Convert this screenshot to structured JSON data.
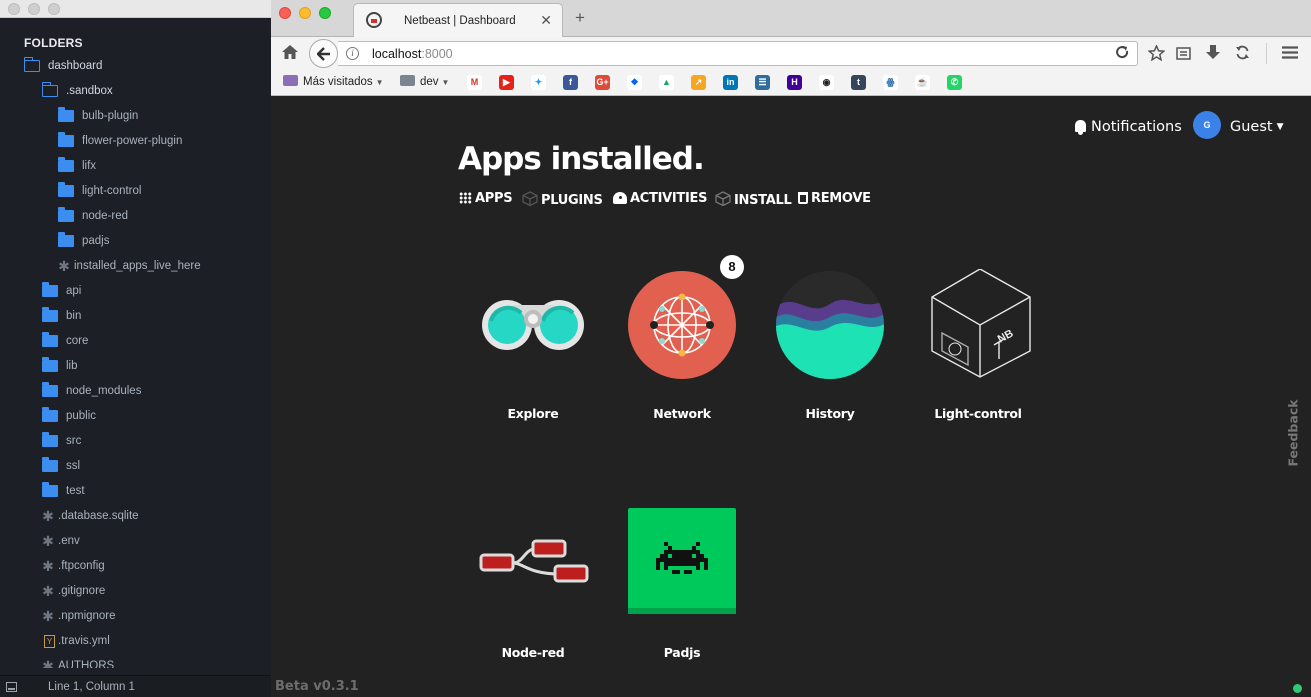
{
  "editor": {
    "header": "FOLDERS",
    "tree": [
      {
        "label": "dashboard",
        "type": "folder-open",
        "depth": 0
      },
      {
        "label": ".sandbox",
        "type": "folder-open",
        "depth": 1
      },
      {
        "label": "bulb-plugin",
        "type": "folder",
        "depth": 2
      },
      {
        "label": "flower-power-plugin",
        "type": "folder",
        "depth": 2
      },
      {
        "label": "lifx",
        "type": "folder",
        "depth": 2
      },
      {
        "label": "light-control",
        "type": "folder",
        "depth": 2
      },
      {
        "label": "node-red",
        "type": "folder",
        "depth": 2
      },
      {
        "label": "padjs",
        "type": "folder",
        "depth": 2
      },
      {
        "label": "installed_apps_live_here",
        "type": "file",
        "depth": 2
      },
      {
        "label": "api",
        "type": "folder",
        "depth": 1
      },
      {
        "label": "bin",
        "type": "folder",
        "depth": 1
      },
      {
        "label": "core",
        "type": "folder",
        "depth": 1
      },
      {
        "label": "lib",
        "type": "folder",
        "depth": 1
      },
      {
        "label": "node_modules",
        "type": "folder",
        "depth": 1
      },
      {
        "label": "public",
        "type": "folder",
        "depth": 1
      },
      {
        "label": "src",
        "type": "folder",
        "depth": 1
      },
      {
        "label": "ssl",
        "type": "folder",
        "depth": 1
      },
      {
        "label": "test",
        "type": "folder",
        "depth": 1
      },
      {
        "label": ".database.sqlite",
        "type": "file",
        "depth": 1
      },
      {
        "label": ".env",
        "type": "file",
        "depth": 1
      },
      {
        "label": ".ftpconfig",
        "type": "file",
        "depth": 1
      },
      {
        "label": ".gitignore",
        "type": "file",
        "depth": 1
      },
      {
        "label": ".npmignore",
        "type": "file",
        "depth": 1
      },
      {
        "label": ".travis.yml",
        "type": "yaml",
        "depth": 1
      },
      {
        "label": "AUTHORS",
        "type": "file",
        "depth": 1
      }
    ],
    "status": "Line 1, Column 1"
  },
  "browser": {
    "tab_title": "Netbeast | Dashboard",
    "tab_close": "✕",
    "new_tab": "+",
    "url_host": "localhost",
    "url_port": ":8000",
    "bookmark_folders": [
      "Más visitados",
      "dev"
    ],
    "bookmark_icons": [
      {
        "name": "gmail",
        "glyph": "M",
        "color": "#ffffff",
        "fg": "#d93025"
      },
      {
        "name": "youtube",
        "glyph": "▶",
        "color": "#e62117",
        "fg": "#ffffff"
      },
      {
        "name": "twitter",
        "glyph": "✦",
        "color": "#ffffff",
        "fg": "#1da1f2"
      },
      {
        "name": "facebook",
        "glyph": "f",
        "color": "#3b5998",
        "fg": "#ffffff"
      },
      {
        "name": "google-plus",
        "glyph": "G+",
        "color": "#dd4b39",
        "fg": "#ffffff"
      },
      {
        "name": "dropbox",
        "glyph": "❖",
        "color": "#ffffff",
        "fg": "#0061fe"
      },
      {
        "name": "google-drive",
        "glyph": "▲",
        "color": "#ffffff",
        "fg": "#1fa463"
      },
      {
        "name": "analytics",
        "glyph": "↗",
        "color": "#f6a623",
        "fg": "#ffffff"
      },
      {
        "name": "linkedin",
        "glyph": "in",
        "color": "#0077b5",
        "fg": "#ffffff"
      },
      {
        "name": "stack",
        "glyph": "☰",
        "color": "#2f6d9e",
        "fg": "#ffffff"
      },
      {
        "name": "heroku",
        "glyph": "H",
        "color": "#430098",
        "fg": "#ffffff"
      },
      {
        "name": "github",
        "glyph": "◉",
        "color": "#ffffff",
        "fg": "#222222"
      },
      {
        "name": "tumblr",
        "glyph": "t",
        "color": "#35465c",
        "fg": "#ffffff"
      },
      {
        "name": "octopus",
        "glyph": "ꙮ",
        "color": "#ffffff",
        "fg": "#2b6fad"
      },
      {
        "name": "coffee",
        "glyph": "☕",
        "color": "#ffffff",
        "fg": "#555555"
      },
      {
        "name": "whatsapp",
        "glyph": "✆",
        "color": "#25d366",
        "fg": "#ffffff"
      }
    ]
  },
  "page": {
    "notifications": "Notifications",
    "avatar_letter": "G",
    "user": "Guest",
    "title": "Apps installed.",
    "subnav": [
      "APPS",
      "PLUGINS",
      "ACTIVITIES",
      "INSTALL",
      "REMOVE"
    ],
    "apps": [
      {
        "label": "Explore",
        "icon": "binoculars-icon"
      },
      {
        "label": "Network",
        "icon": "network-globe-icon",
        "badge": "8"
      },
      {
        "label": "History",
        "icon": "history-wave-icon"
      },
      {
        "label": "Light-control",
        "icon": "box-icon"
      },
      {
        "label": "Node-red",
        "icon": "node-red-icon"
      },
      {
        "label": "Padjs",
        "icon": "space-invader-icon"
      }
    ],
    "beta": "Beta v0.3.1",
    "feedback": "Feedback"
  },
  "colors": {
    "accent_blue": "#3b8ef0",
    "page_bg": "#222222",
    "editor_bg": "#1c2026",
    "network_red": "#e2604f",
    "history_teal": "#1de3b4",
    "padjs_green": "#00c95b",
    "status_green": "#2ecc71"
  }
}
